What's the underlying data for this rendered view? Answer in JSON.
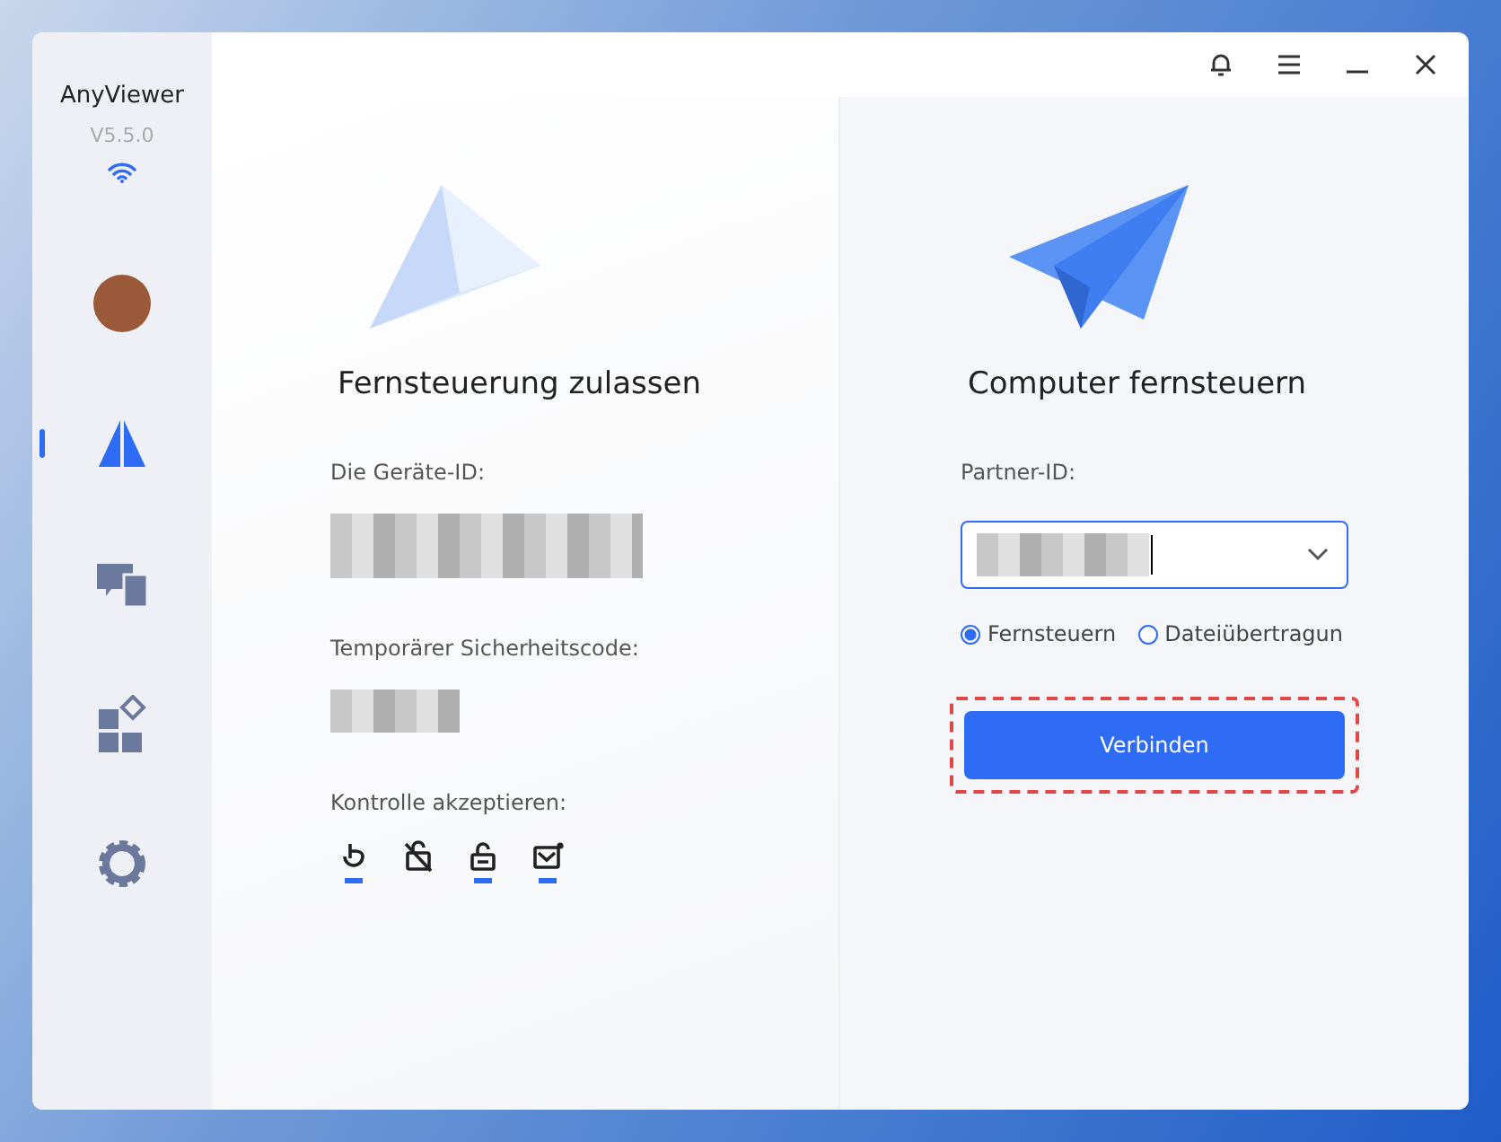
{
  "app": {
    "name": "AnyViewer",
    "version": "V5.5.0"
  },
  "sidebar": {
    "items": [
      {
        "kind": "avatar",
        "selected": false
      },
      {
        "kind": "remote",
        "selected": true
      },
      {
        "kind": "devices",
        "selected": false
      },
      {
        "kind": "apps",
        "selected": false
      },
      {
        "kind": "settings",
        "selected": false
      }
    ]
  },
  "left_panel": {
    "title": "Fernsteuerung zulassen",
    "device_id_label": "Die Geräte-ID:",
    "security_code_label": "Temporärer Sicherheitscode:",
    "accept_label": "Kontrolle akzeptieren:",
    "permissions": [
      {
        "kind": "mouse",
        "enabled": true
      },
      {
        "kind": "lock-off",
        "enabled": false
      },
      {
        "kind": "lock",
        "enabled": true
      },
      {
        "kind": "mail",
        "enabled": true
      }
    ]
  },
  "right_panel": {
    "title": "Computer fernsteuern",
    "partner_label": "Partner-ID:",
    "modes": [
      {
        "label": "Fernsteuern",
        "selected": true
      },
      {
        "label": "Dateiübertragun",
        "selected": false
      }
    ],
    "connect_button": "Verbinden",
    "highlighted": true
  }
}
